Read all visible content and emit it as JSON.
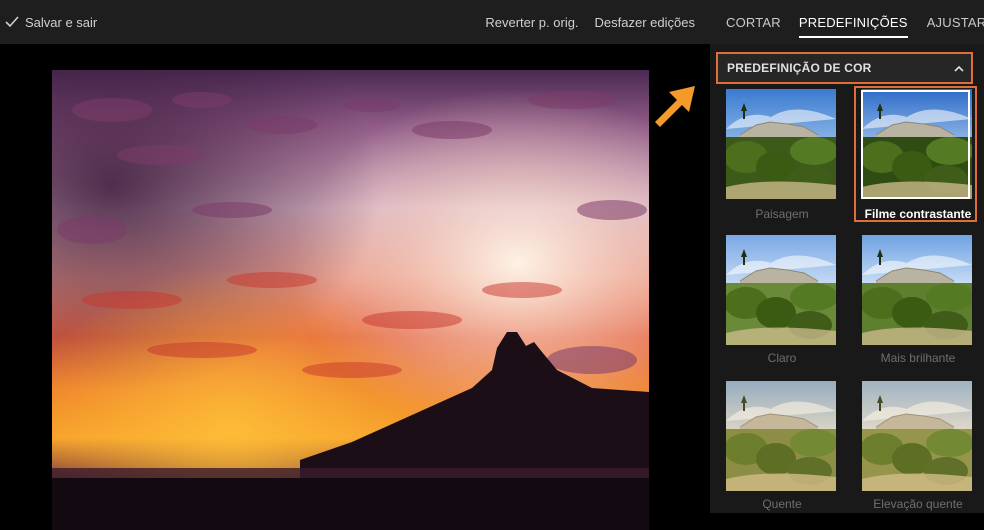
{
  "topbar": {
    "save_label": "Salvar e sair",
    "revert_label": "Reverter p. orig.",
    "undo_label": "Desfazer edições"
  },
  "tabs": [
    {
      "label": "CORTAR",
      "active": false
    },
    {
      "label": "PREDEFINIÇÕES",
      "active": true
    },
    {
      "label": "AJUSTAR",
      "active": false
    }
  ],
  "section": {
    "title": "PREDEFINIÇÃO DE COR",
    "expanded": true
  },
  "presets": [
    {
      "label": "Paisagem",
      "selected": false
    },
    {
      "label": "Filme contrastante",
      "selected": true
    },
    {
      "label": "Claro",
      "selected": false
    },
    {
      "label": "Mais brilhante",
      "selected": false
    },
    {
      "label": "Quente",
      "selected": false
    },
    {
      "label": "Elevação quente",
      "selected": false
    }
  ],
  "icons": {
    "save": "check-icon",
    "collapse": "chevron-up-icon",
    "pointer": "arrow-icon"
  },
  "colors": {
    "highlight": "#e06d3a",
    "accent_arrow": "#f39a2b",
    "panel_bg": "#191919",
    "bar_bg": "#1e1e1e"
  }
}
